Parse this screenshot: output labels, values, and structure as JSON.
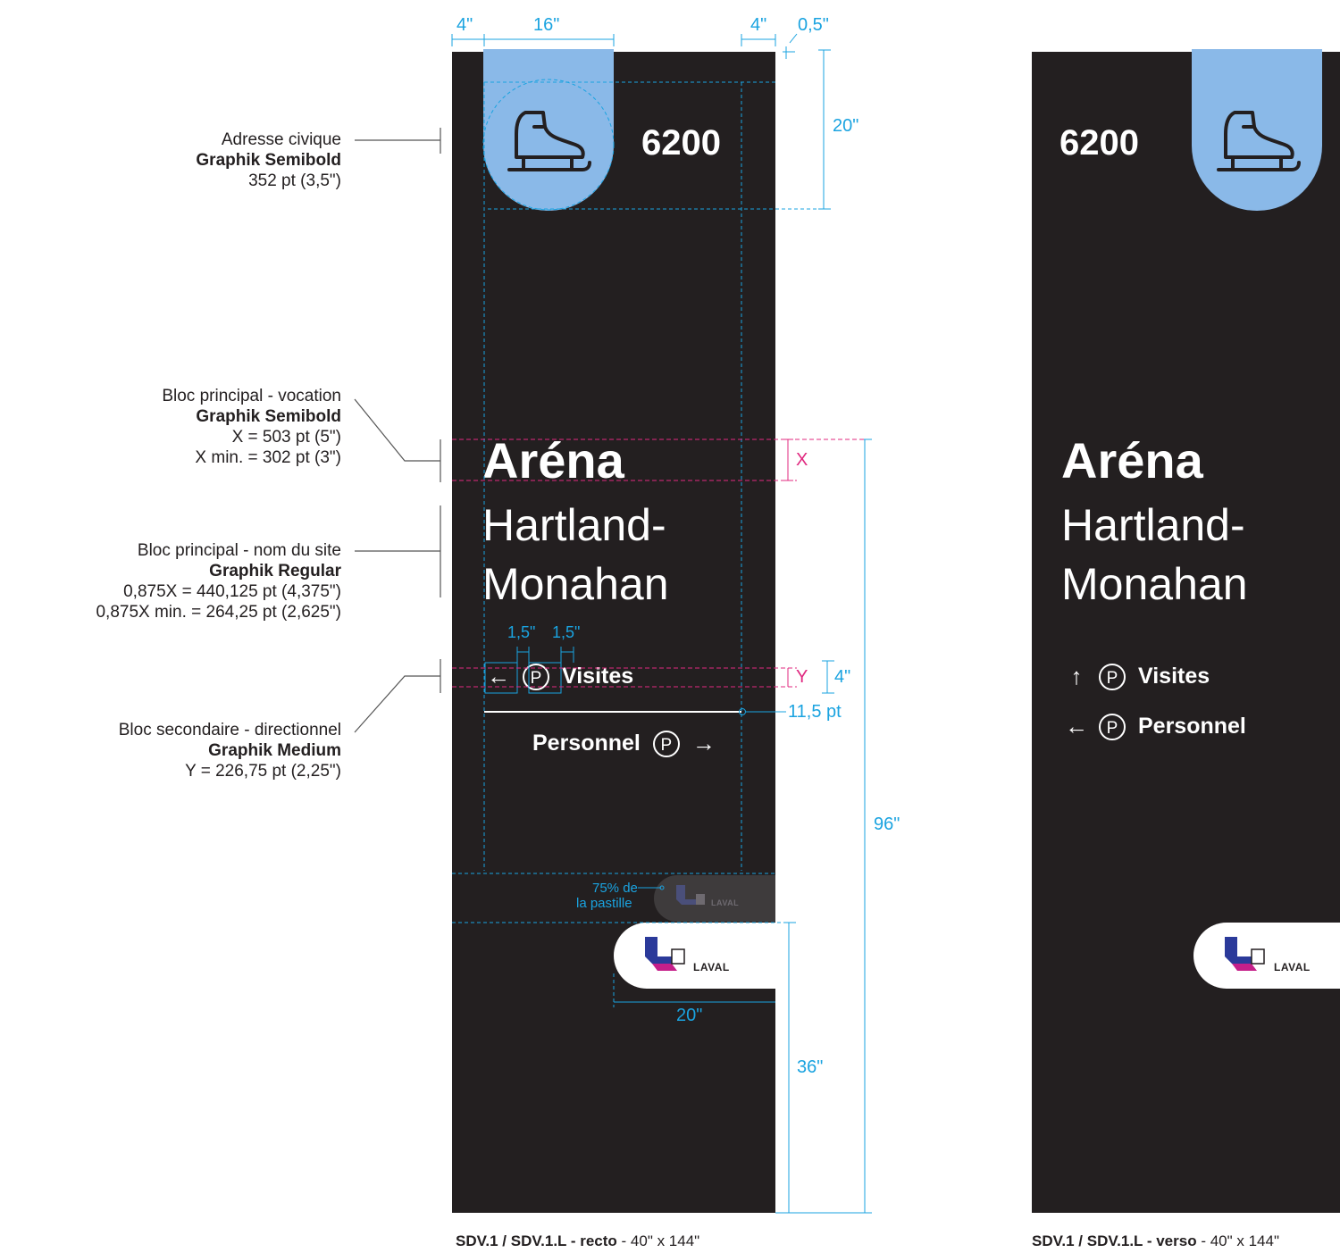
{
  "annotations": [
    {
      "title": "Adresse civique",
      "font": "Graphik Semibold",
      "spec": [
        "352 pt (3,5\")"
      ]
    },
    {
      "title": "Bloc principal - vocation",
      "font": "Graphik Semibold",
      "spec": [
        "X = 503 pt (5\")",
        "X min. = 302 pt (3\")"
      ]
    },
    {
      "title": "Bloc principal - nom du site",
      "font": "Graphik Regular",
      "spec": [
        "0,875X = 440,125 pt (4,375\")",
        "0,875X min. = 264,25 pt (2,625\")"
      ]
    },
    {
      "title": "Bloc secondaire - directionnel",
      "font": "Graphik Medium",
      "spec": [
        "Y = 226,75 pt (2,25\")"
      ]
    }
  ],
  "sign": {
    "address": "6200",
    "vocation": "Aréna",
    "name_line1": "Hartland-",
    "name_line2": "Monahan",
    "parking_glyph": "P",
    "recto": [
      {
        "arrow": "←",
        "label": "Visites"
      },
      {
        "arrow": "→",
        "label": "Personnel"
      }
    ],
    "verso": [
      {
        "arrow": "↑",
        "label": "Visites"
      },
      {
        "arrow": "←",
        "label": "Personnel"
      }
    ],
    "logo_text": "LAVAL",
    "icon": "ice-skate-icon"
  },
  "dimensions": {
    "top_margin_left": "4\"",
    "top_tab_width": "16\"",
    "top_margin_right": "4\"",
    "top_offset": "0,5\"",
    "tab_height": "20\"",
    "x_label": "X",
    "y_label": "Y",
    "dir_gap_a": "1,5\"",
    "dir_gap_b": "1,5\"",
    "dir_height": "4\"",
    "rule_weight": "11,5 pt",
    "total_height": "96\"",
    "pill_note_line1": "75% de",
    "pill_note_line2": "la pastille",
    "pill_width": "20\"",
    "base_height": "36\""
  },
  "captions": {
    "recto_bold": "SDV.1 / SDV.1.L - recto",
    "recto_size": " - 40\" x 144\"",
    "verso_bold": "SDV.1 / SDV.1.L - verso",
    "verso_size": " - 40\" x 144\""
  },
  "colors": {
    "panel": "#231f20",
    "tab": "#8ab9e8",
    "dimension": "#1aa3e0",
    "guide_magenta": "#e0287f",
    "logo_blue": "#2b3a9a",
    "logo_magenta": "#c51f8a"
  }
}
